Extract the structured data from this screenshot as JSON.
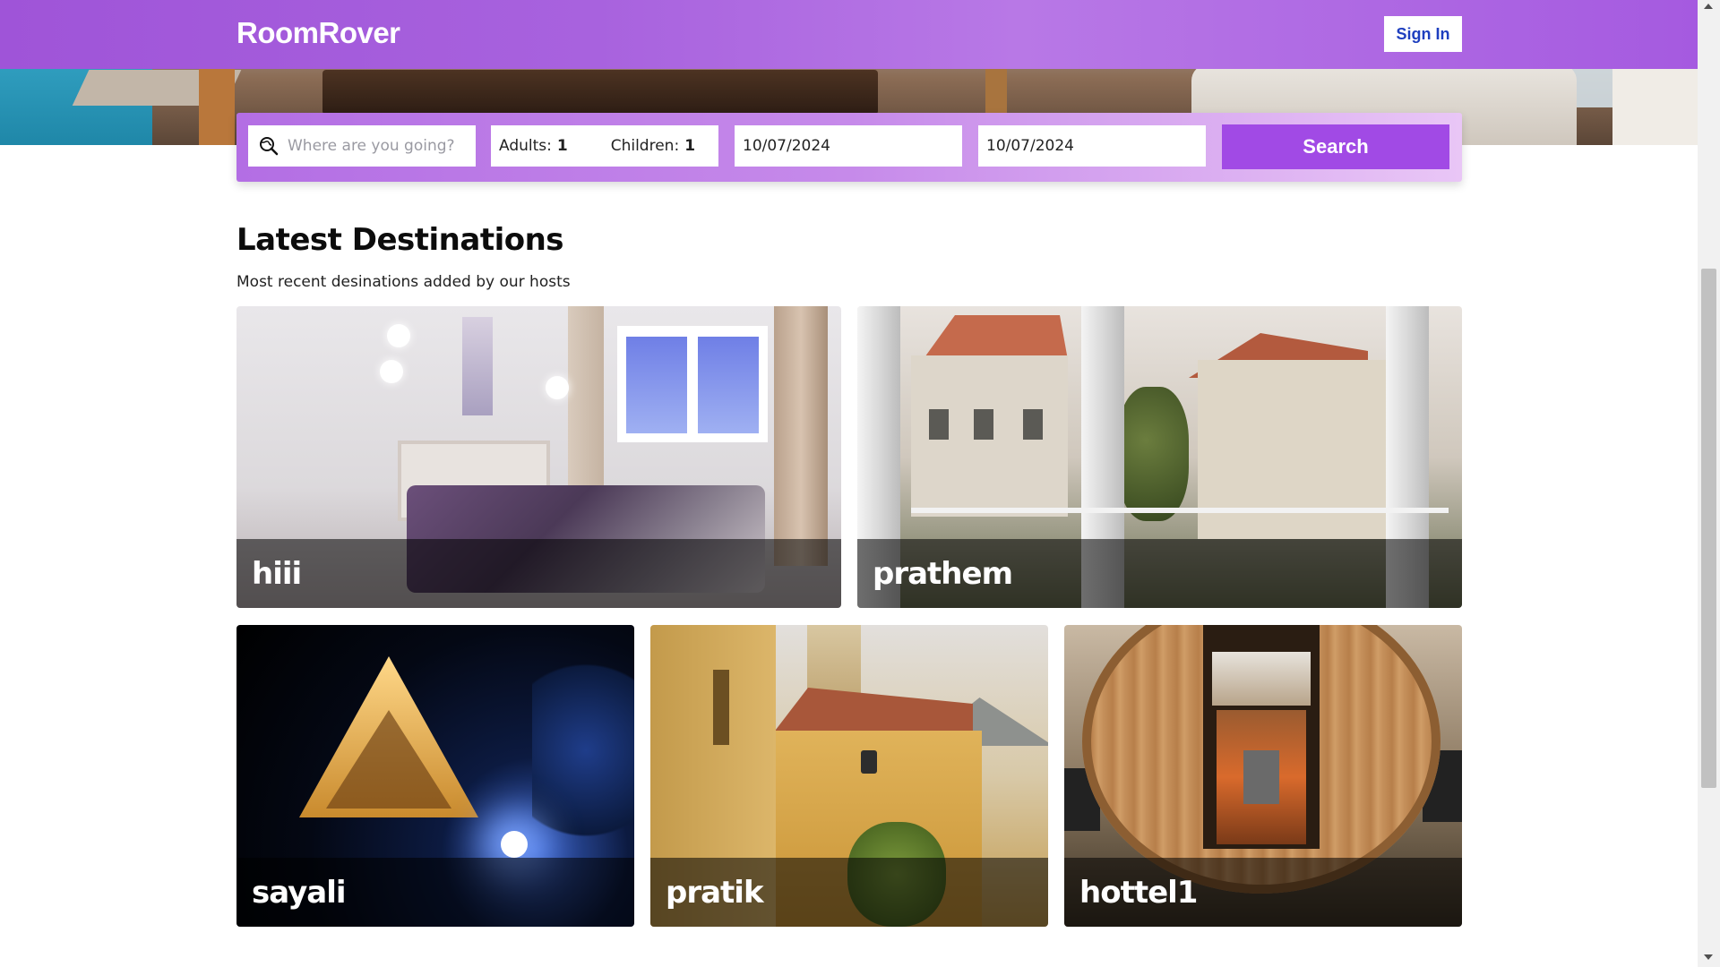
{
  "header": {
    "logo": "RoomRover",
    "signin_label": "Sign In"
  },
  "search": {
    "destination_placeholder": "Where are you going?",
    "adults_label": "Adults:",
    "adults_value": "1",
    "children_label": "Children:",
    "children_value": "1",
    "checkin": "10/07/2024",
    "checkout": "10/07/2024",
    "search_label": "Search"
  },
  "section": {
    "title": "Latest Destinations",
    "subtitle": "Most recent desinations added by our hosts"
  },
  "destinations": [
    {
      "name": "hiii"
    },
    {
      "name": "prathem"
    },
    {
      "name": "sayali"
    },
    {
      "name": "pratik"
    },
    {
      "name": "hottel1"
    }
  ],
  "colors": {
    "brand_purple": "#a14ae5",
    "signin_text": "#1e3fbf"
  },
  "icons": {
    "search_field": "globe-search-icon"
  }
}
